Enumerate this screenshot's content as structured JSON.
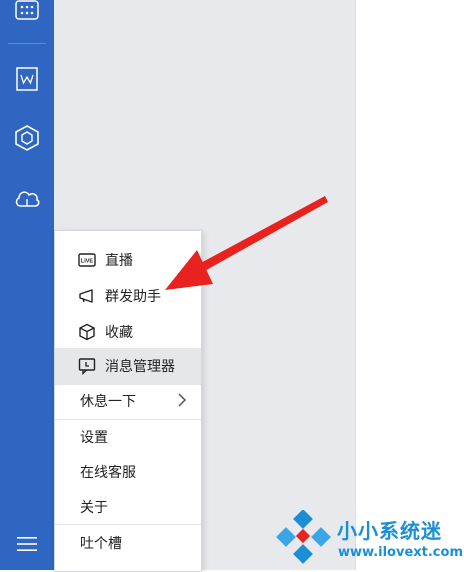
{
  "sidebar": {
    "icons": [
      "apps-grid-icon",
      "document-w-icon",
      "cube-icon",
      "cloud-icon",
      "hamburger-menu-icon"
    ]
  },
  "menu": {
    "items": [
      {
        "label": "直播",
        "icon": "live-icon"
      },
      {
        "label": "群发助手",
        "icon": "megaphone-icon"
      },
      {
        "label": "收藏",
        "icon": "cube-icon"
      },
      {
        "label": "消息管理器",
        "icon": "message-manager-icon",
        "highlighted": true
      },
      {
        "label": "休息一下",
        "submenu": true
      },
      {
        "label": "设置"
      },
      {
        "label": "在线客服"
      },
      {
        "label": "关于"
      },
      {
        "label": "吐个槽"
      }
    ]
  },
  "watermark": {
    "name": "小小系统迷",
    "url": "www.ilovext.com"
  },
  "colors": {
    "sidebar": "#2e66c1",
    "content": "#e8e9ec",
    "arrow": "#e8231f",
    "watermark": "#1a8fd6"
  }
}
